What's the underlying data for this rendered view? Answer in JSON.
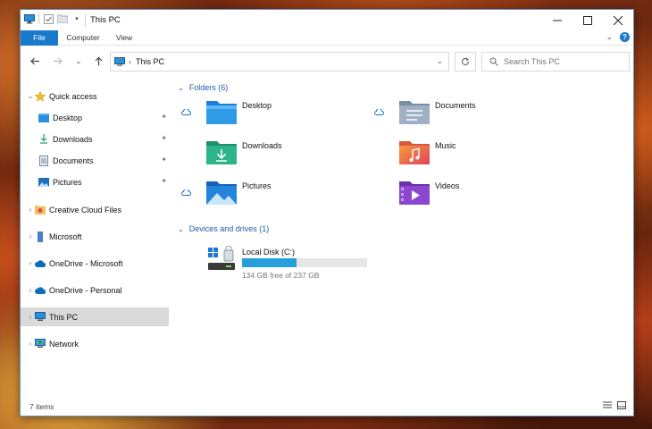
{
  "window": {
    "title": "This PC"
  },
  "ribbon": {
    "tabs": [
      "File",
      "Computer",
      "View"
    ]
  },
  "address": {
    "path": "This PC",
    "separator": "›"
  },
  "search": {
    "placeholder": "Search This PC"
  },
  "sidebar": {
    "quick_access": "Quick access",
    "quick_items": [
      "Desktop",
      "Downloads",
      "Documents",
      "Pictures"
    ],
    "items": [
      "Creative Cloud Files",
      "Microsoft",
      "OneDrive - Microsoft",
      "OneDrive - Personal",
      "This PC",
      "Network"
    ],
    "selected": "This PC"
  },
  "folders": {
    "header": "Folders (6)",
    "items": [
      "Desktop",
      "Documents",
      "Downloads",
      "Music",
      "Pictures",
      "Videos"
    ]
  },
  "drives": {
    "header": "Devices and drives (1)",
    "items": [
      {
        "name": "Local Disk (C:)",
        "free_text": "134 GB free of 237 GB",
        "used_fraction": 0.435
      }
    ]
  },
  "status": {
    "count": "7 items"
  },
  "colors": {
    "accent": "#1979ca",
    "usage_bar": "#26a0da",
    "group_header": "#1d5ea8"
  }
}
